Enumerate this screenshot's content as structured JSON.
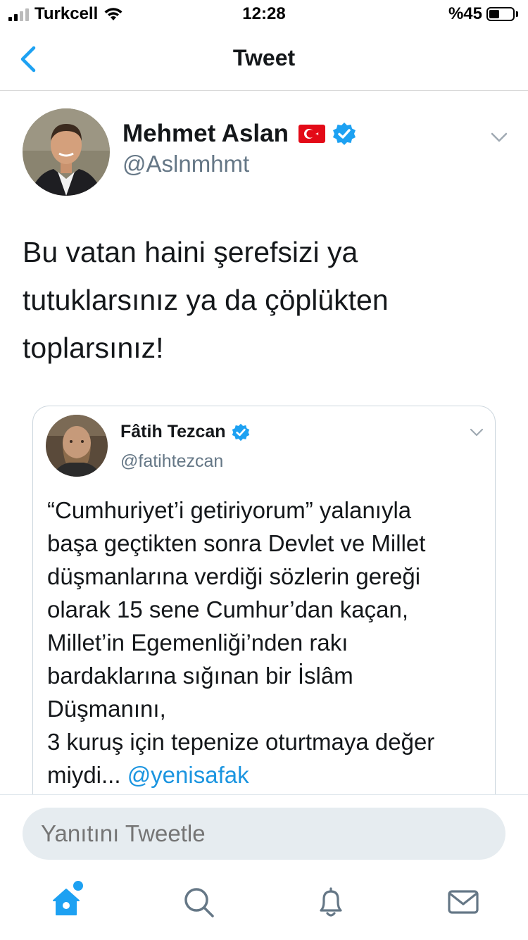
{
  "status_bar": {
    "carrier": "Turkcell",
    "time": "12:28",
    "battery": "%45"
  },
  "nav": {
    "title": "Tweet"
  },
  "tweet": {
    "author_name": "Mehmet Aslan",
    "handle": "@Aslnmhmt",
    "text": "Bu vatan haini şerefsizi ya tutuklarsınız ya da çöplükten toplarsınız!"
  },
  "quoted_tweet": {
    "author_name": "Fâtih Tezcan",
    "handle": "@fatihtezcan",
    "text_lines": [
      "“Cumhuriyet’i getiriyorum” yalanıyla",
      "başa geçtikten sonra Devlet ve Millet",
      "düşmanlarına verdiği sözlerin gereği",
      "olarak 15 sene Cumhur’dan kaçan,",
      "Millet’in Egemenliği’nden rakı",
      "bardaklarına sığınan bir İslâm",
      "Düşmanını,",
      "3 kuruş için tepenize oturtmaya değer",
      "miydi..."
    ],
    "mention": "@yenisafak"
  },
  "reply": {
    "placeholder": "Yanıtını Tweetle"
  },
  "colors": {
    "accent": "#1da1f2",
    "secondary_text": "#657786"
  },
  "icons": {
    "tabs": [
      "home-icon",
      "search-icon",
      "notifications-icon",
      "messages-icon"
    ]
  }
}
